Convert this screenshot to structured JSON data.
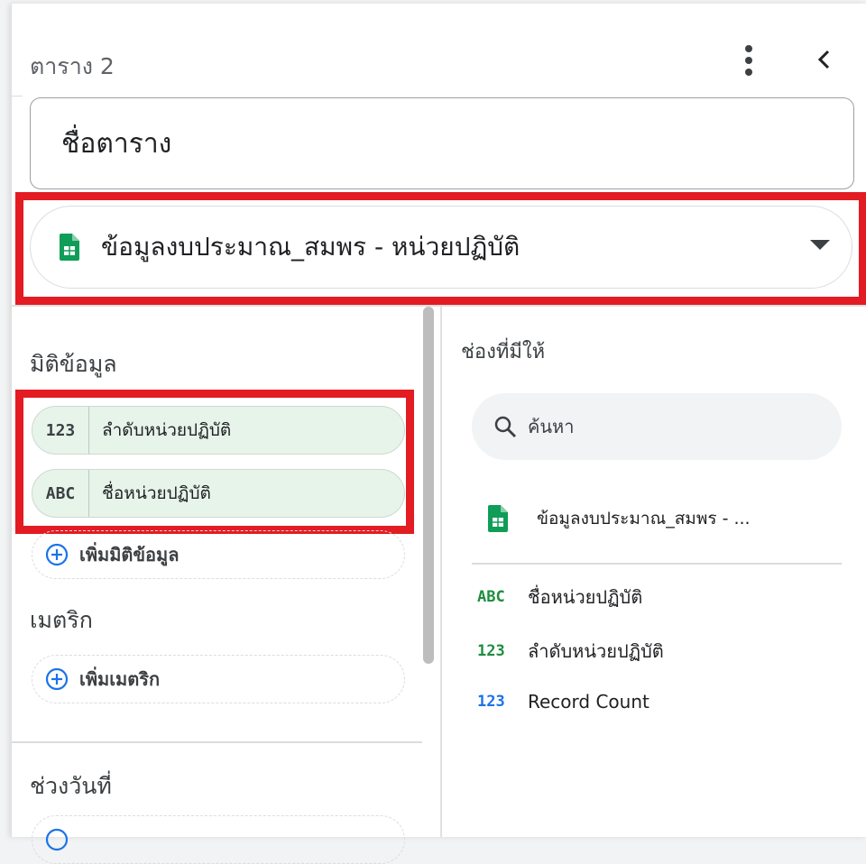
{
  "header": {
    "title": "ตาราง 2"
  },
  "table_name": {
    "placeholder": "ชื่อตาราง"
  },
  "data_source": {
    "name": "ข้อมูลงบประมาณ_สมพร - หน่วยปฏิบัติ"
  },
  "dimensions": {
    "label": "มิติข้อมูล",
    "items": [
      {
        "type": "123",
        "label": "ลำดับหน่วยปฏิบัติ"
      },
      {
        "type": "ABC",
        "label": "ชื่อหน่วยปฏิบัติ"
      }
    ],
    "add_label": "เพิ่มมิติข้อมูล"
  },
  "metrics": {
    "label": "เมตริก",
    "add_label": "เพิ่มเมตริก"
  },
  "date_range": {
    "label": "ช่วงวันที่"
  },
  "available_fields": {
    "title": "ช่องที่มีให้",
    "search_placeholder": "ค้นหา",
    "source_name": "ข้อมูลงบประมาณ_สมพร - ...",
    "fields": [
      {
        "type": "ABC",
        "label": "ชื่อหน่วยปฏิบัติ",
        "type_color": "#1e8e3e"
      },
      {
        "type": "123",
        "label": "ลำดับหน่วยปฏิบัติ",
        "type_color": "#1e8e3e"
      },
      {
        "type": "123",
        "label": "Record Count",
        "type_color": "#1a73e8"
      }
    ]
  },
  "colors": {
    "highlight": "#e31b23",
    "dimension_chip": "#e6f4ea",
    "sheets_green": "#0f9d58",
    "metric_blue": "#1a73e8",
    "add_icon_blue": "#1a73e8"
  },
  "icons": [
    "more-vert-icon",
    "chevron-left-icon",
    "google-sheets-icon",
    "dropdown-arrow-icon",
    "add-circle-icon",
    "search-icon"
  ]
}
